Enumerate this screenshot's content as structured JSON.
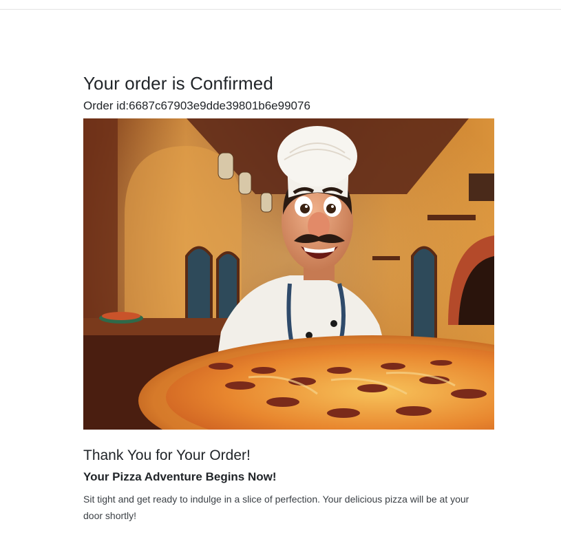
{
  "confirmation": {
    "title": "Your order is Confirmed",
    "order_id_label": "Order id:",
    "order_id_value": "6687c67903e9dde39801b6e99076"
  },
  "hero_image": {
    "subject": "smiling-cartoon-chef-with-pepperoni-pizza"
  },
  "thank_you": {
    "heading": "Thank You for Your Order!",
    "subheading": "Your Pizza Adventure Begins Now!",
    "message": "Sit tight and get ready to indulge in a slice of perfection. Your delicious pizza will be at your door shortly!"
  },
  "colors": {
    "text": "#212529",
    "pizza_crust": "#d98a3a",
    "sauce": "#c94f22",
    "wall": "#c77a2e"
  }
}
